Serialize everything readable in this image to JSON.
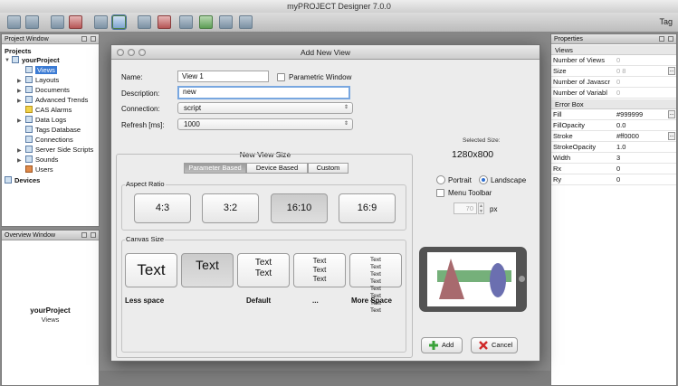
{
  "app": {
    "title": "myPROJECT Designer 7.0.0",
    "tag_label": "Tag"
  },
  "toolbar": {
    "icons": [
      "save-icon",
      "save-all-icon",
      "copy-icon",
      "delete-icon",
      "monitor-icon",
      "add-view-icon",
      "view-icon",
      "remove-view-icon",
      "export-icon",
      "import-icon",
      "print-icon",
      "copy-view-icon"
    ]
  },
  "project_window": {
    "title": "Project Window",
    "header": "Projects",
    "project_name": "yourProject",
    "items": [
      {
        "label": "Views",
        "selected": true
      },
      {
        "label": "Layouts"
      },
      {
        "label": "Documents"
      },
      {
        "label": "Advanced Trends"
      },
      {
        "label": "CAS Alarms"
      },
      {
        "label": "Data Logs"
      },
      {
        "label": "Tags Database"
      },
      {
        "label": "Connections"
      },
      {
        "label": "Server Side Scripts"
      },
      {
        "label": "Sounds"
      },
      {
        "label": "Users"
      }
    ],
    "devices": "Devices"
  },
  "overview_window": {
    "title": "Overview Window",
    "project": "yourProject",
    "item": "Views"
  },
  "properties": {
    "title": "Properties",
    "group1": "Views",
    "rows1": [
      {
        "key": "Number of Views",
        "value": "0",
        "grey": true
      },
      {
        "key": "Size",
        "value": "0 8",
        "grey": true,
        "button": "..."
      },
      {
        "key": "Number of Javascr",
        "value": "0",
        "grey": true
      },
      {
        "key": "Number of Variabl",
        "value": "0",
        "grey": true
      }
    ],
    "group2": "Error Box",
    "rows2": [
      {
        "key": "Fill",
        "value": "#999999",
        "button": "..."
      },
      {
        "key": "FillOpacity",
        "value": "0.0"
      },
      {
        "key": "Stroke",
        "value": "#ff0000",
        "button": "..."
      },
      {
        "key": "StrokeOpacity",
        "value": "1.0"
      },
      {
        "key": "Width",
        "value": "3"
      },
      {
        "key": "Rx",
        "value": "0"
      },
      {
        "key": "Ry",
        "value": "0"
      }
    ]
  },
  "dialog": {
    "title": "Add New View",
    "name_label": "Name:",
    "name_value": "View 1",
    "parametric_label": "Parametric Window",
    "description_label": "Description:",
    "description_value": "new",
    "connection_label": "Connection:",
    "connection_value": "script",
    "refresh_label": "Refresh [ms]:",
    "refresh_value": "1000",
    "new_view_size": "New View Size",
    "tabs": [
      "Parameter Based",
      "Device Based",
      "Custom"
    ],
    "aspect_ratio_label": "Aspect Ratio",
    "ratios": [
      "4:3",
      "3:2",
      "16:10",
      "16:9"
    ],
    "canvas_size_label": "Canvas Size",
    "canvas_text": "Text",
    "space_labels": [
      "Less space",
      "Default",
      "...",
      "More Space"
    ],
    "selected_size_label": "Selected Size:",
    "selected_size_value": "1280x800",
    "portrait_label": "Portrait",
    "landscape_label": "Landscape",
    "menu_toolbar_label": "Menu Toolbar",
    "px_value": "70",
    "px_unit": "px",
    "add_label": "Add",
    "cancel_label": "Cancel"
  },
  "colors": {
    "selection": "#3b7bd4",
    "preview_green": "#75b07a",
    "preview_red": "#a86a6e",
    "preview_blue": "#6b6fb0"
  }
}
